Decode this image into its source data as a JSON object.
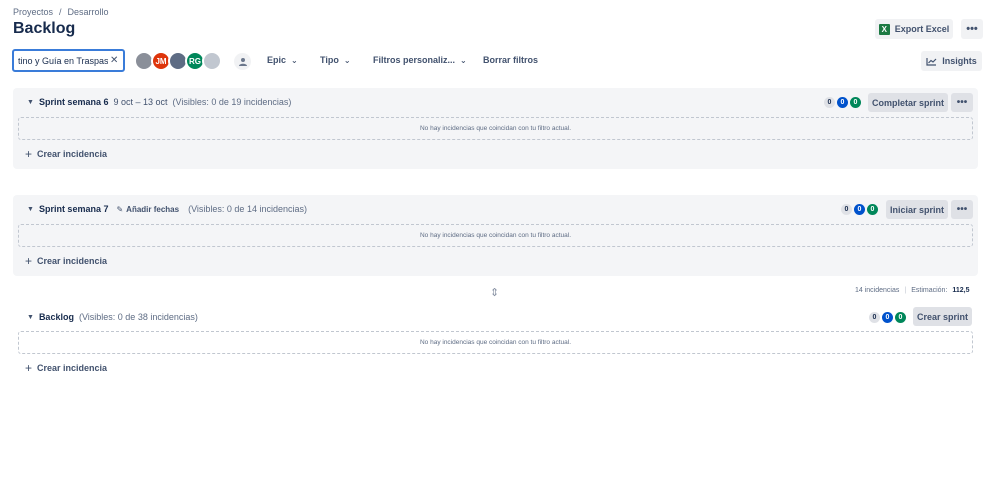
{
  "breadcrumb": [
    "Proyectos",
    "/",
    "Desarrollo"
  ],
  "page_title": "Backlog",
  "header": {
    "export_label": "Export Excel",
    "more": "•••"
  },
  "toolbar": {
    "search_value": "tino y Guía en Traspaso",
    "clear": "✕",
    "avatars": [
      "",
      "JM",
      "",
      "RG",
      ""
    ],
    "filters": [
      {
        "label": "Epic",
        "chevron": "⌄"
      },
      {
        "label": "Tipo",
        "chevron": "⌄"
      },
      {
        "label": "Filtros personaliz...",
        "chevron": "⌄"
      }
    ],
    "clear_filters": "Borrar filtros",
    "insights_label": "Insights"
  },
  "sprints": [
    {
      "name": "Sprint semana 6",
      "dates": "9 oct – 13 oct",
      "visible": "(Visibles: 0 de 19 incidencias)",
      "counts": [
        "0",
        "0",
        "0"
      ],
      "action": "Completar sprint",
      "more": "•••",
      "empty_text": "No hay incidencias que coincidan con tu filtro actual.",
      "create_label": "Crear incidencia"
    },
    {
      "name": "Sprint semana 7",
      "add_dates": "Añadir fechas",
      "visible": "(Visibles: 0 de 14 incidencias)",
      "counts": [
        "0",
        "0",
        "0"
      ],
      "action": "Iniciar sprint",
      "more": "•••",
      "empty_text": "No hay incidencias que coincidan con tu filtro actual.",
      "create_label": "Crear incidencia"
    }
  ],
  "summary": {
    "issues": "14 incidencias",
    "estimate_label": "Estimación:",
    "estimate_value": "112,5"
  },
  "backlog": {
    "name": "Backlog",
    "visible": "(Visibles: 0 de 38 incidencias)",
    "counts": [
      "0",
      "0",
      "0"
    ],
    "action": "Crear sprint",
    "empty_text": "No hay incidencias que coincidan con tu filtro actual.",
    "create_label": "Crear incidencia"
  },
  "colors": {
    "accent": "#0052cc",
    "done": "#00875a",
    "focus": "#3a7cd9",
    "panel": "#f4f5f7"
  }
}
